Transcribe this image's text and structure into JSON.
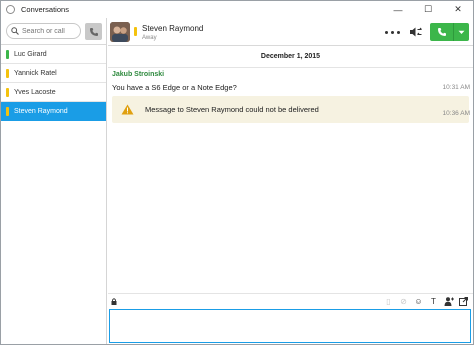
{
  "window": {
    "title": "Conversations",
    "minimize": "—",
    "maximize": "☐",
    "close": "✕"
  },
  "sidebar": {
    "search_placeholder": "Search or call",
    "contacts": [
      {
        "name": "Luc Girard",
        "status_color": "#3cb64a",
        "active": false
      },
      {
        "name": "Yannick Ratel",
        "status_color": "#f4c20d",
        "active": false
      },
      {
        "name": "Yves Lacoste",
        "status_color": "#f4c20d",
        "active": false
      },
      {
        "name": "Steven Raymond",
        "status_color": "#f4c20d",
        "active": true
      }
    ]
  },
  "header": {
    "name": "Steven Raymond",
    "presence": "Away",
    "status_color": "#f4c20d"
  },
  "conversation": {
    "date": "December 1, 2015",
    "sender": "Jakub Stroinski",
    "message": "You have a S6 Edge or a Note Edge?",
    "message_time": "10:31 AM",
    "alert": "Message to Steven Raymond could not be delivered",
    "alert_time": "10:36 AM"
  },
  "composer": {
    "value": "",
    "placeholder": ""
  },
  "colors": {
    "accent": "#1a9de6",
    "call_green": "#3cb64a",
    "away": "#f4c20d",
    "available": "#3cb64a",
    "sender": "#2e8a3e",
    "alert_bg": "#f6f2e1"
  }
}
